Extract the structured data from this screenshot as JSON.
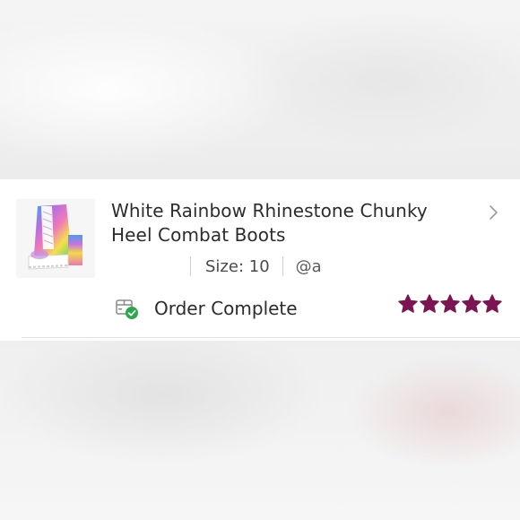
{
  "listing": {
    "title": "White Rainbow Rhinestone Chunky Heel Combat Boots",
    "size_text": "Size: 10",
    "username": "@a",
    "thumbnail_icon": "rainbow-boot-image",
    "chevron_icon": "chevron-right-icon"
  },
  "order": {
    "status_label": "Order Complete",
    "status_icon": "package-check-icon",
    "status_icon_color": "#2aa84a"
  },
  "rating": {
    "value": 5,
    "max": 5,
    "star_color": "#7b1450"
  }
}
